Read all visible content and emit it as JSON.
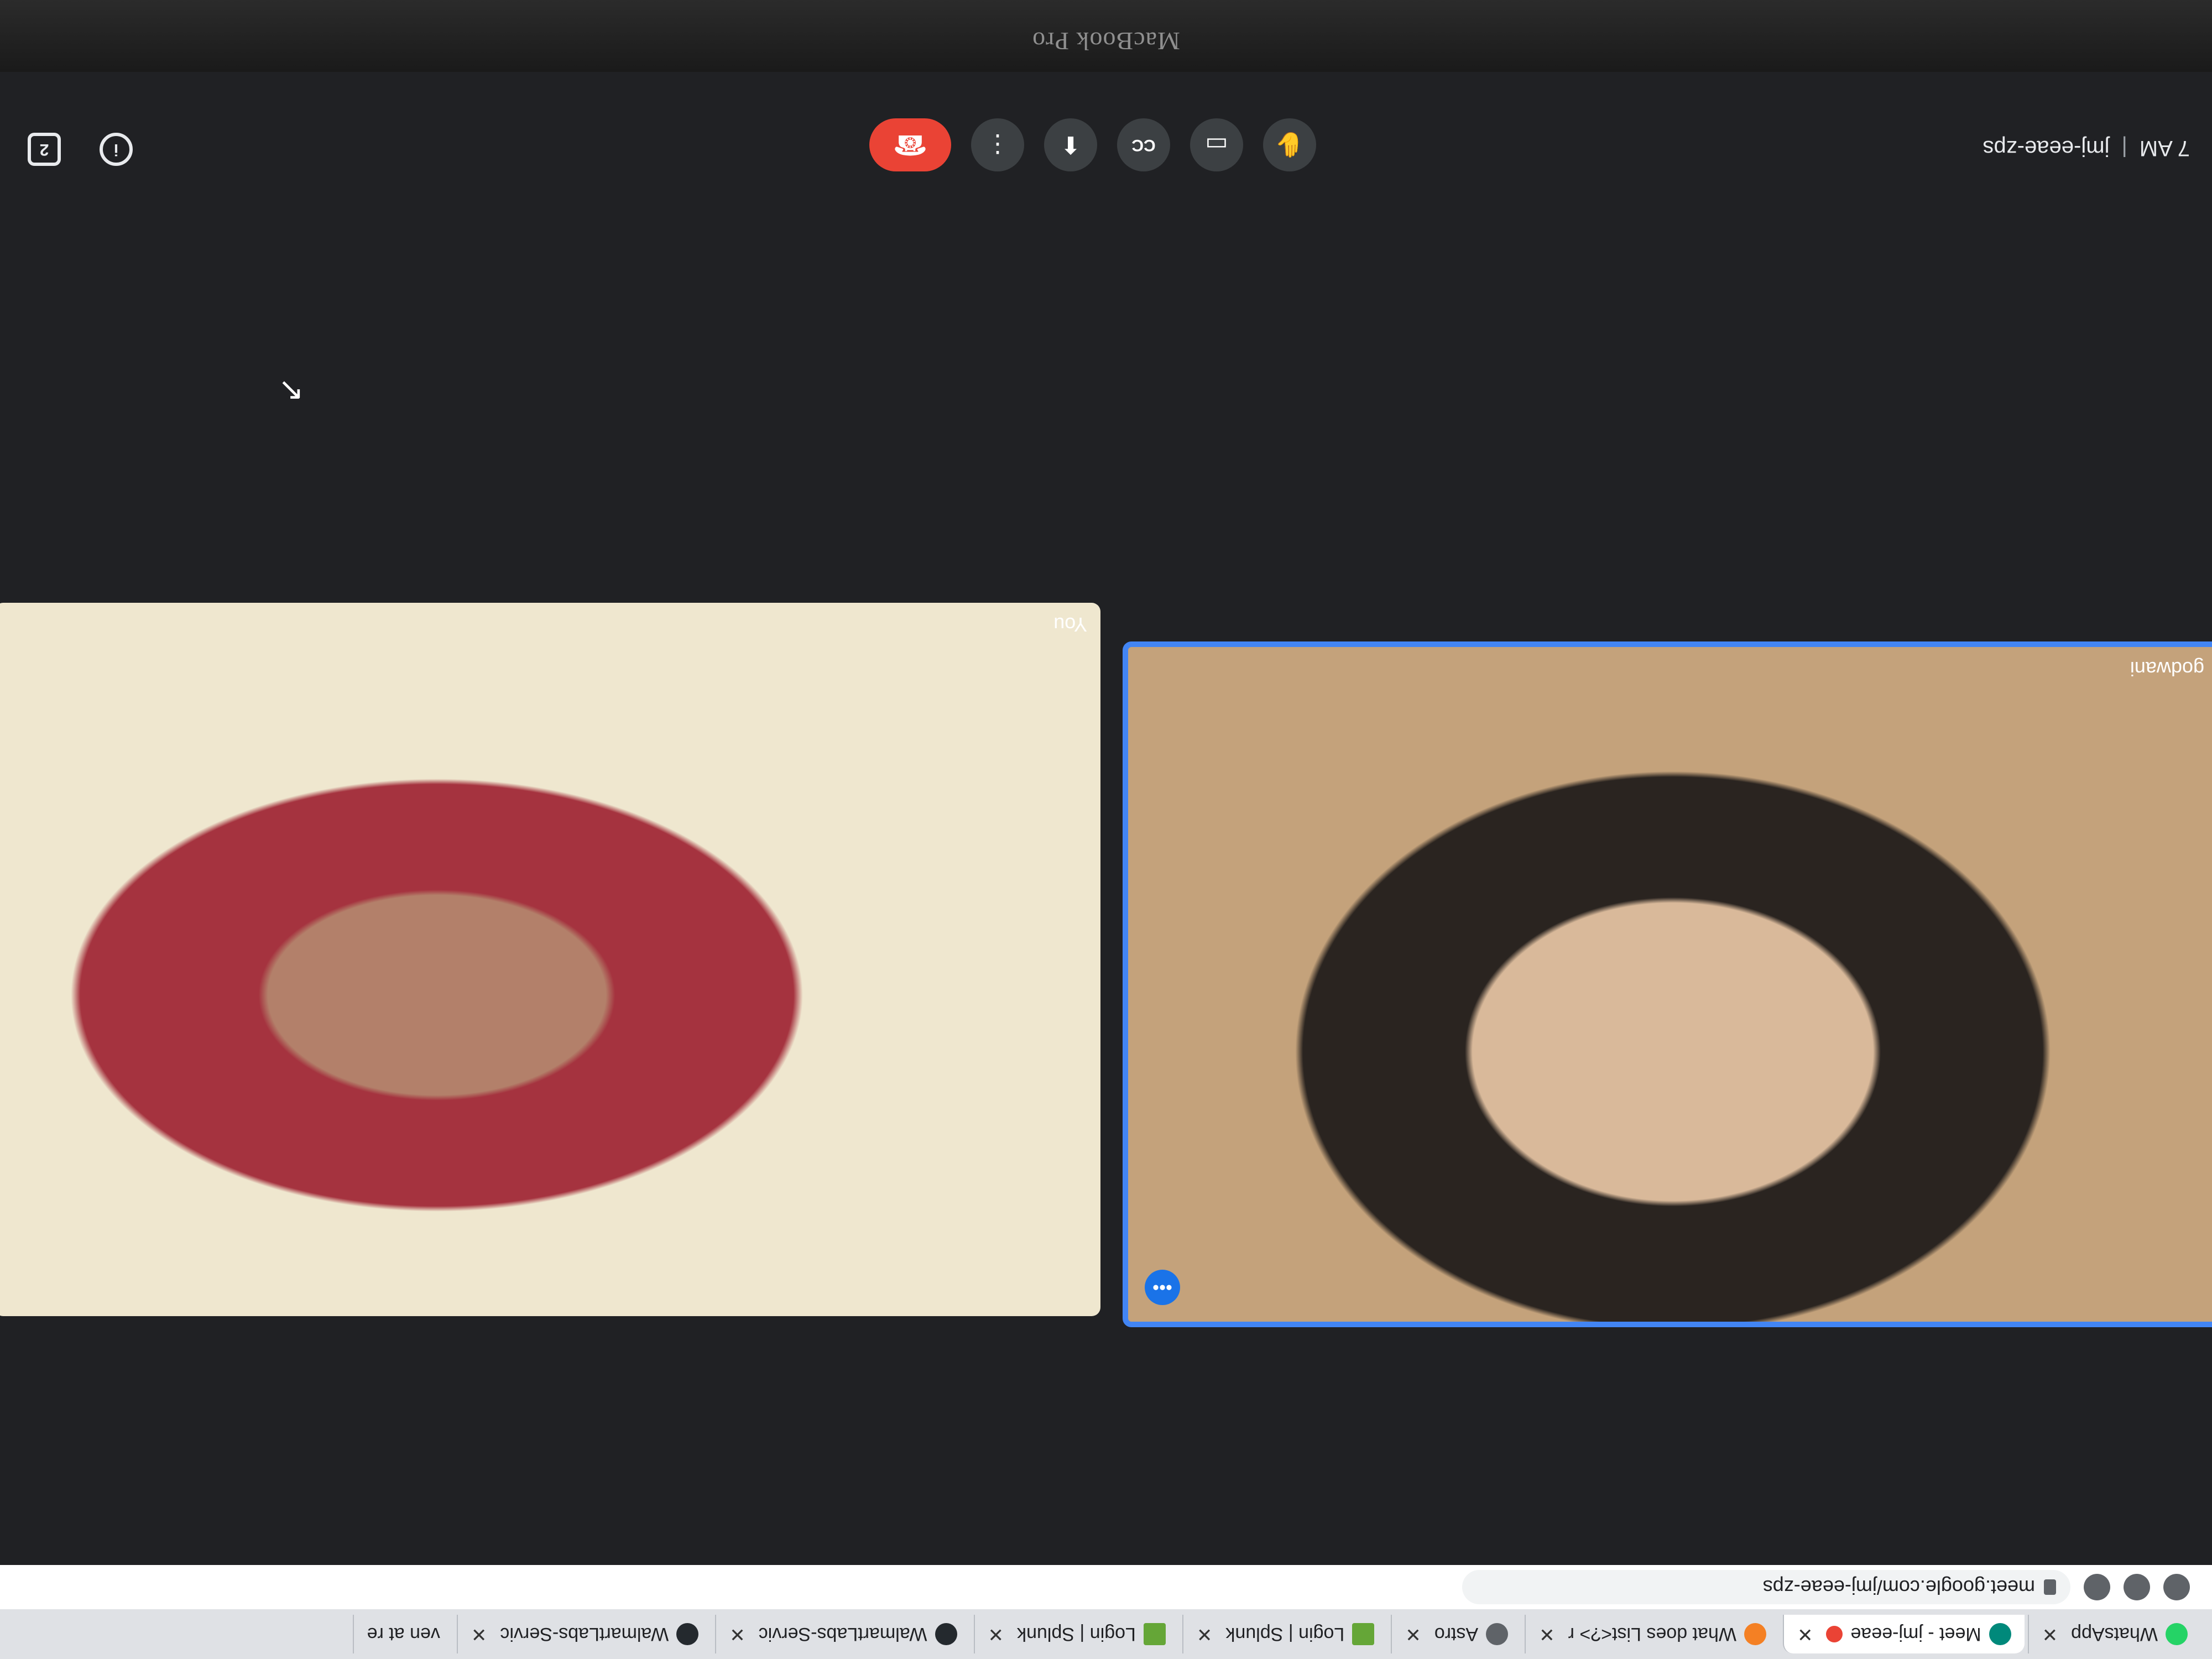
{
  "bezel": {
    "label": "MacBook Pro"
  },
  "browser": {
    "tabs": [
      {
        "label": "WhatsApp",
        "icon": "whatsapp-icon",
        "color": "#25d366"
      },
      {
        "label": "Meet - jmj-eeae",
        "icon": "meet-icon",
        "color": "#00897b",
        "active": true
      },
      {
        "label": "What does List<?> r",
        "icon": "stackoverflow-icon",
        "color": "#f48024"
      },
      {
        "label": "Astro",
        "icon": "astro-icon",
        "color": "#5f6368"
      },
      {
        "label": "Login | Splunk",
        "icon": "splunk-icon",
        "color": "#65a637"
      },
      {
        "label": "Login | Splunk",
        "icon": "splunk-icon",
        "color": "#65a637"
      },
      {
        "label": "WalmartLabs-Servic",
        "icon": "github-icon",
        "color": "#24292e"
      },
      {
        "label": "WalmartLabs-Servic",
        "icon": "github-icon",
        "color": "#24292e"
      },
      {
        "label": "ven at re",
        "icon": "page-icon",
        "color": "#9aa0a6"
      }
    ],
    "url": "meet.google.com/jmj-eeae-zps"
  },
  "meet": {
    "remote_participant_name": "godwani",
    "local_participant_name": "You",
    "meeting_time": "7 AM",
    "separator": "|",
    "meeting_code": "jmj-eeae-zps",
    "tile_menu_glyph": "•••"
  },
  "controls": [
    {
      "name": "raise-hand-button",
      "icon": "hand-icon",
      "glyph": "✋"
    },
    {
      "name": "present-button",
      "icon": "present-icon",
      "glyph": "▭"
    },
    {
      "name": "captions-button",
      "icon": "captions-icon",
      "glyph": "CC"
    },
    {
      "name": "present-now-button",
      "icon": "screen-share-icon",
      "glyph": "⬆"
    },
    {
      "name": "more-options-button",
      "icon": "more-vert-icon",
      "glyph": "⋮"
    },
    {
      "name": "leave-call-button",
      "icon": "phone-hangup-icon",
      "glyph": "☎"
    }
  ],
  "right_icons": [
    {
      "name": "meeting-details-button",
      "icon": "info-icon",
      "glyph": "i"
    },
    {
      "name": "people-button",
      "icon": "people-icon",
      "glyph": "2"
    }
  ],
  "colors": {
    "end_call": "#ea4335",
    "active_speaker_border": "#4285f4",
    "meet_background": "#202124"
  }
}
